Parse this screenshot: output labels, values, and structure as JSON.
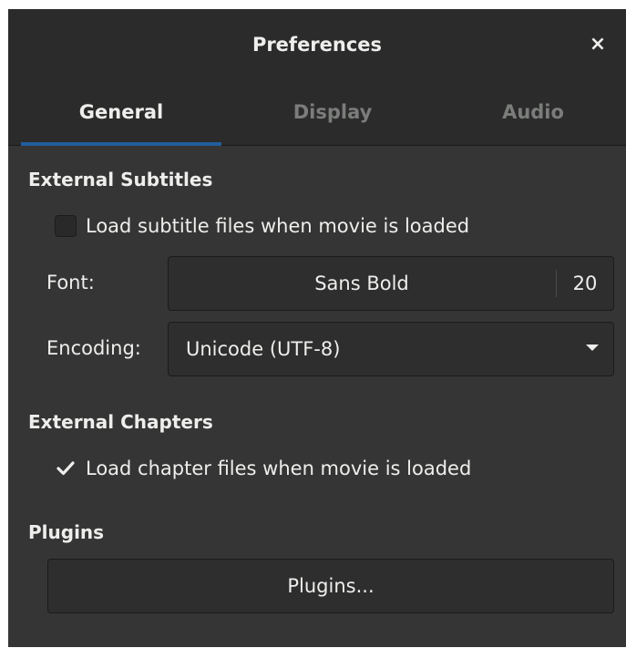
{
  "window": {
    "title": "Preferences",
    "close_glyph": "×"
  },
  "tabs": [
    {
      "label": "General",
      "active": true
    },
    {
      "label": "Display",
      "active": false
    },
    {
      "label": "Audio",
      "active": false
    }
  ],
  "external_subtitles": {
    "heading": "External Subtitles",
    "load_checkbox": {
      "label": "Load subtitle files when movie is loaded",
      "checked": false
    },
    "font": {
      "label": "Font:",
      "name": "Sans Bold",
      "size": "20"
    },
    "encoding": {
      "label": "Encoding:",
      "value": "Unicode (UTF-8)"
    }
  },
  "external_chapters": {
    "heading": "External Chapters",
    "load_checkbox": {
      "label": "Load chapter files when movie is loaded",
      "checked": true
    }
  },
  "plugins": {
    "heading": "Plugins",
    "button_label": "Plugins..."
  },
  "colors": {
    "background": "#353535",
    "headerbar": "#2b2b2b",
    "accent": "#215d9c",
    "text": "#eeeeec",
    "inactive_tab_text": "#7b7d7b"
  },
  "icons": {
    "close": "close-icon",
    "check": "checkmark-icon",
    "dropdown": "chevron-down-icon"
  }
}
